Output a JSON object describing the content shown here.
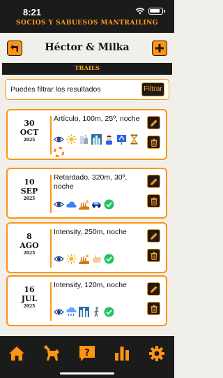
{
  "status": {
    "time": "8:21"
  },
  "app_title": "SOCIOS Y SABUESOS MANTRAILING",
  "header": {
    "title": "Héctor & Milka"
  },
  "section": {
    "title": "TRAILS"
  },
  "filter": {
    "label": "Puedes filtrar los resultados",
    "button": "Filtrar"
  },
  "trails": [
    {
      "day": "30",
      "month": "OCT",
      "year": "2025",
      "description": "Artículo, 100m, 25º, noche",
      "icons": [
        "eye-icon",
        "sun-icon",
        "urban-building-icon",
        "city-icon",
        "person-icon",
        "flag-sign-icon",
        "hourglass-icon",
        "lifebuoy-icon"
      ]
    },
    {
      "day": "10",
      "month": "SEP",
      "year": "2025",
      "description": "Retardado, 320m, 30º, noche",
      "icons": [
        "eye-icon",
        "cloud-icon",
        "field-icon",
        "car-icon",
        "check-icon"
      ]
    },
    {
      "day": "8",
      "month": "AGO",
      "year": "2025",
      "description": "Intensity, 250m, noche",
      "icons": [
        "eye-icon",
        "sun-icon",
        "field-icon",
        "hand-icon",
        "check-icon"
      ]
    },
    {
      "day": "16",
      "month": "JUL",
      "year": "2025",
      "description": "Intensity, 120m, noche",
      "icons": [
        "eye-icon",
        "rain-icon",
        "city-icon",
        "walker-icon",
        "check-icon"
      ]
    }
  ],
  "tabs": [
    "home-icon",
    "dog-icon",
    "question-icon",
    "stats-icon",
    "settings-icon"
  ],
  "colors": {
    "accent": "#ff9412",
    "dark": "#1b1b1b",
    "background": "#f0efe9"
  }
}
